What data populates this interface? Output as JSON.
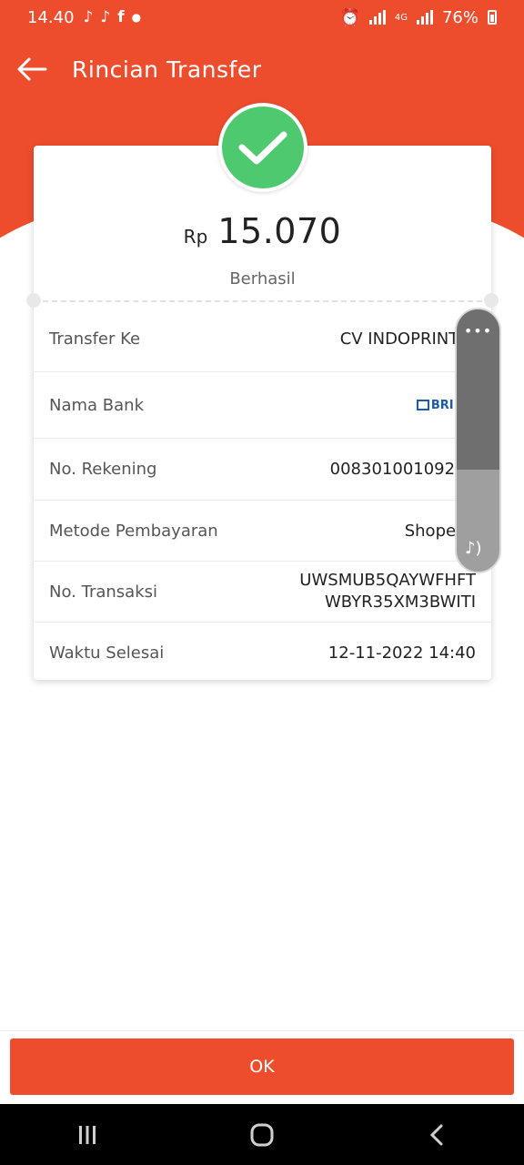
{
  "status_bar": {
    "time": "14.40",
    "app_icons": [
      "tiktok-icon",
      "tiktok-icon",
      "facebook-icon",
      "dot-icon"
    ],
    "network_label": "4G",
    "battery_percent": "76%"
  },
  "app_bar": {
    "title": "Rincian Transfer"
  },
  "summary": {
    "currency": "Rp",
    "amount": "15.070",
    "status": "Berhasil"
  },
  "details": {
    "rows": [
      {
        "label": "Transfer Ke",
        "value": "CV INDOPRINTIN"
      },
      {
        "label": "Nama Bank",
        "logo": "BRI",
        "value": "B"
      },
      {
        "label": "No. Rekening",
        "value": "00830100109259"
      },
      {
        "label": "Metode Pembayaran",
        "value": "ShopeeP"
      },
      {
        "label": "No. Transaksi",
        "value": "UWSMUB5QAYWFHFT WBYR35XM3BWITI"
      },
      {
        "label": "Waktu Selesai",
        "value": "12-11-2022 14:40"
      }
    ]
  },
  "floating_widget": {
    "menu_icon": "more-dots-icon",
    "sound_icon": "music-note-icon"
  },
  "footer": {
    "ok_label": "OK"
  },
  "colors": {
    "brand": "#ee4d2d",
    "success": "#4fc96f"
  }
}
